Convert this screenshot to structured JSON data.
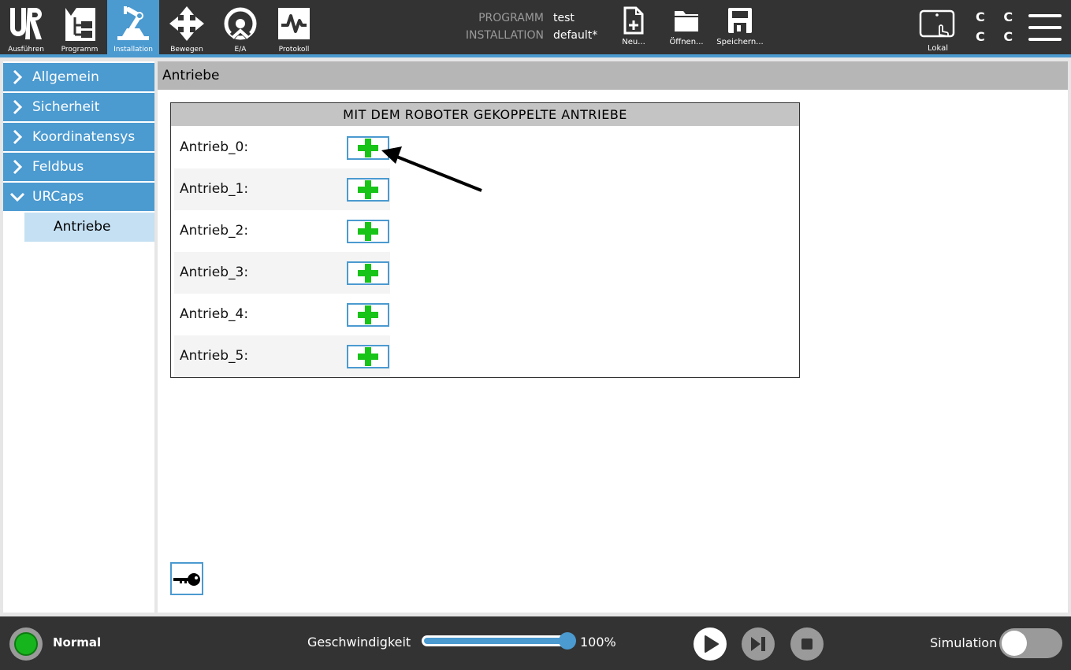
{
  "topbar": {
    "nav": [
      {
        "label": "Ausführen",
        "icon": "ur-logo-icon"
      },
      {
        "label": "Programm",
        "icon": "program-tree-icon"
      },
      {
        "label": "Installation",
        "icon": "robot-arm-icon",
        "active": true
      },
      {
        "label": "Bewegen",
        "icon": "move-arrows-icon"
      },
      {
        "label": "E/A",
        "icon": "io-icon"
      },
      {
        "label": "Protokoll",
        "icon": "log-icon"
      }
    ],
    "program_key": "PROGRAMM",
    "program_value": "test",
    "installation_key": "INSTALLATION",
    "installation_value": "default*",
    "file": {
      "new": "Neu...",
      "open": "Öffnen...",
      "save": "Speichern..."
    },
    "mode": "Lokal",
    "cc_row1": "C C",
    "cc_row2": "C C"
  },
  "sidebar": {
    "items": [
      {
        "label": "Allgemein",
        "expanded": false
      },
      {
        "label": "Sicherheit",
        "expanded": false
      },
      {
        "label": "Koordinatensys",
        "expanded": false
      },
      {
        "label": "Feldbus",
        "expanded": false
      },
      {
        "label": "URCaps",
        "expanded": true
      }
    ],
    "sub_item": "Antriebe"
  },
  "main": {
    "header": "Antriebe",
    "panel_title": "MIT DEM ROBOTER GEKOPPELTE ANTRIEBE",
    "drives": [
      "Antrieb_0:",
      "Antrieb_1:",
      "Antrieb_2:",
      "Antrieb_3:",
      "Antrieb_4:",
      "Antrieb_5:"
    ]
  },
  "bottombar": {
    "status": "Normal",
    "speed_label": "Geschwindigkeit",
    "speed_percent": 100,
    "speed_value": "100%",
    "simulation_label": "Simulation",
    "simulation_on": false
  },
  "colors": {
    "accent": "#4b9ad0",
    "bar": "#333333",
    "plus": "#17c417",
    "status_ok": "#17b51d"
  }
}
